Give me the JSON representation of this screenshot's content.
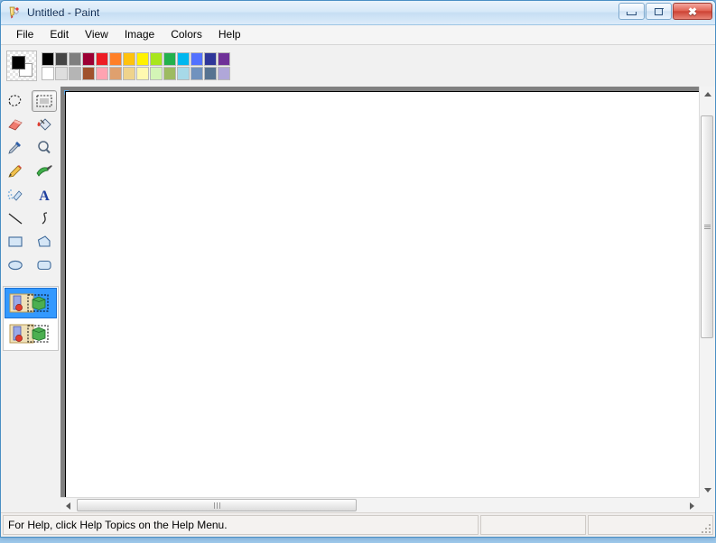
{
  "window": {
    "title": "Untitled - Paint",
    "icon": "paint-palette-icon",
    "controls": {
      "minimize": "Minimize",
      "maximize": "Maximize",
      "close": "Close"
    }
  },
  "menu": {
    "items": [
      {
        "label": "File"
      },
      {
        "label": "Edit"
      },
      {
        "label": "View"
      },
      {
        "label": "Image"
      },
      {
        "label": "Colors"
      },
      {
        "label": "Help"
      }
    ]
  },
  "palette": {
    "foreground": "#000000",
    "background": "#ffffff",
    "row_top": [
      "#000000",
      "#464646",
      "#7f7f7f",
      "#9c0033",
      "#ed1c24",
      "#ff7f27",
      "#ffc20e",
      "#fff200",
      "#a8e61d",
      "#22b14c",
      "#00b7ef",
      "#5271ff",
      "#2f3699",
      "#6f3198"
    ],
    "row_bottom": [
      "#ffffff",
      "#dedede",
      "#b5b5b5",
      "#a0522d",
      "#ffa3b1",
      "#dfa06e",
      "#efd38c",
      "#fff9b0",
      "#d3f5b6",
      "#9dbb61",
      "#a7d9e8",
      "#7092be",
      "#577391",
      "#b0a7d9"
    ]
  },
  "toolbox": {
    "tools": [
      {
        "name": "free-form-select",
        "label": "Free-Form Select",
        "selected": false
      },
      {
        "name": "rectangle-select",
        "label": "Select",
        "selected": true
      },
      {
        "name": "eraser",
        "label": "Eraser/Color Eraser",
        "selected": false
      },
      {
        "name": "fill-with-color",
        "label": "Fill With Color",
        "selected": false
      },
      {
        "name": "pick-color",
        "label": "Pick Color",
        "selected": false
      },
      {
        "name": "magnifier",
        "label": "Magnifier",
        "selected": false
      },
      {
        "name": "pencil",
        "label": "Pencil",
        "selected": false
      },
      {
        "name": "brush",
        "label": "Brush",
        "selected": false
      },
      {
        "name": "airbrush",
        "label": "Airbrush",
        "selected": false
      },
      {
        "name": "text",
        "label": "Text",
        "selected": false
      },
      {
        "name": "line",
        "label": "Line",
        "selected": false
      },
      {
        "name": "curve",
        "label": "Curve",
        "selected": false
      },
      {
        "name": "rectangle",
        "label": "Rectangle",
        "selected": false
      },
      {
        "name": "polygon",
        "label": "Polygon",
        "selected": false
      },
      {
        "name": "ellipse",
        "label": "Ellipse",
        "selected": false
      },
      {
        "name": "rounded-rectangle",
        "label": "Rounded Rectangle",
        "selected": false
      }
    ],
    "options": [
      {
        "name": "selection-opaque",
        "label": "Opaque selection background",
        "selected": true
      },
      {
        "name": "selection-transparent",
        "label": "Transparent selection background",
        "selected": false
      }
    ]
  },
  "canvas": {
    "background": "#ffffff",
    "workspace_background": "#808080"
  },
  "scrollbars": {
    "vertical": {
      "up": "scroll-up",
      "down": "scroll-down",
      "thumb_top_pct": 3,
      "thumb_height_pct": 56
    },
    "horizontal": {
      "left": "scroll-left",
      "right": "scroll-right",
      "thumb_left_pct": 3,
      "thumb_width_pct": 45
    }
  },
  "statusbar": {
    "hint": "For Help, click Help Topics on the Help Menu.",
    "panel2": "",
    "panel3": ""
  }
}
